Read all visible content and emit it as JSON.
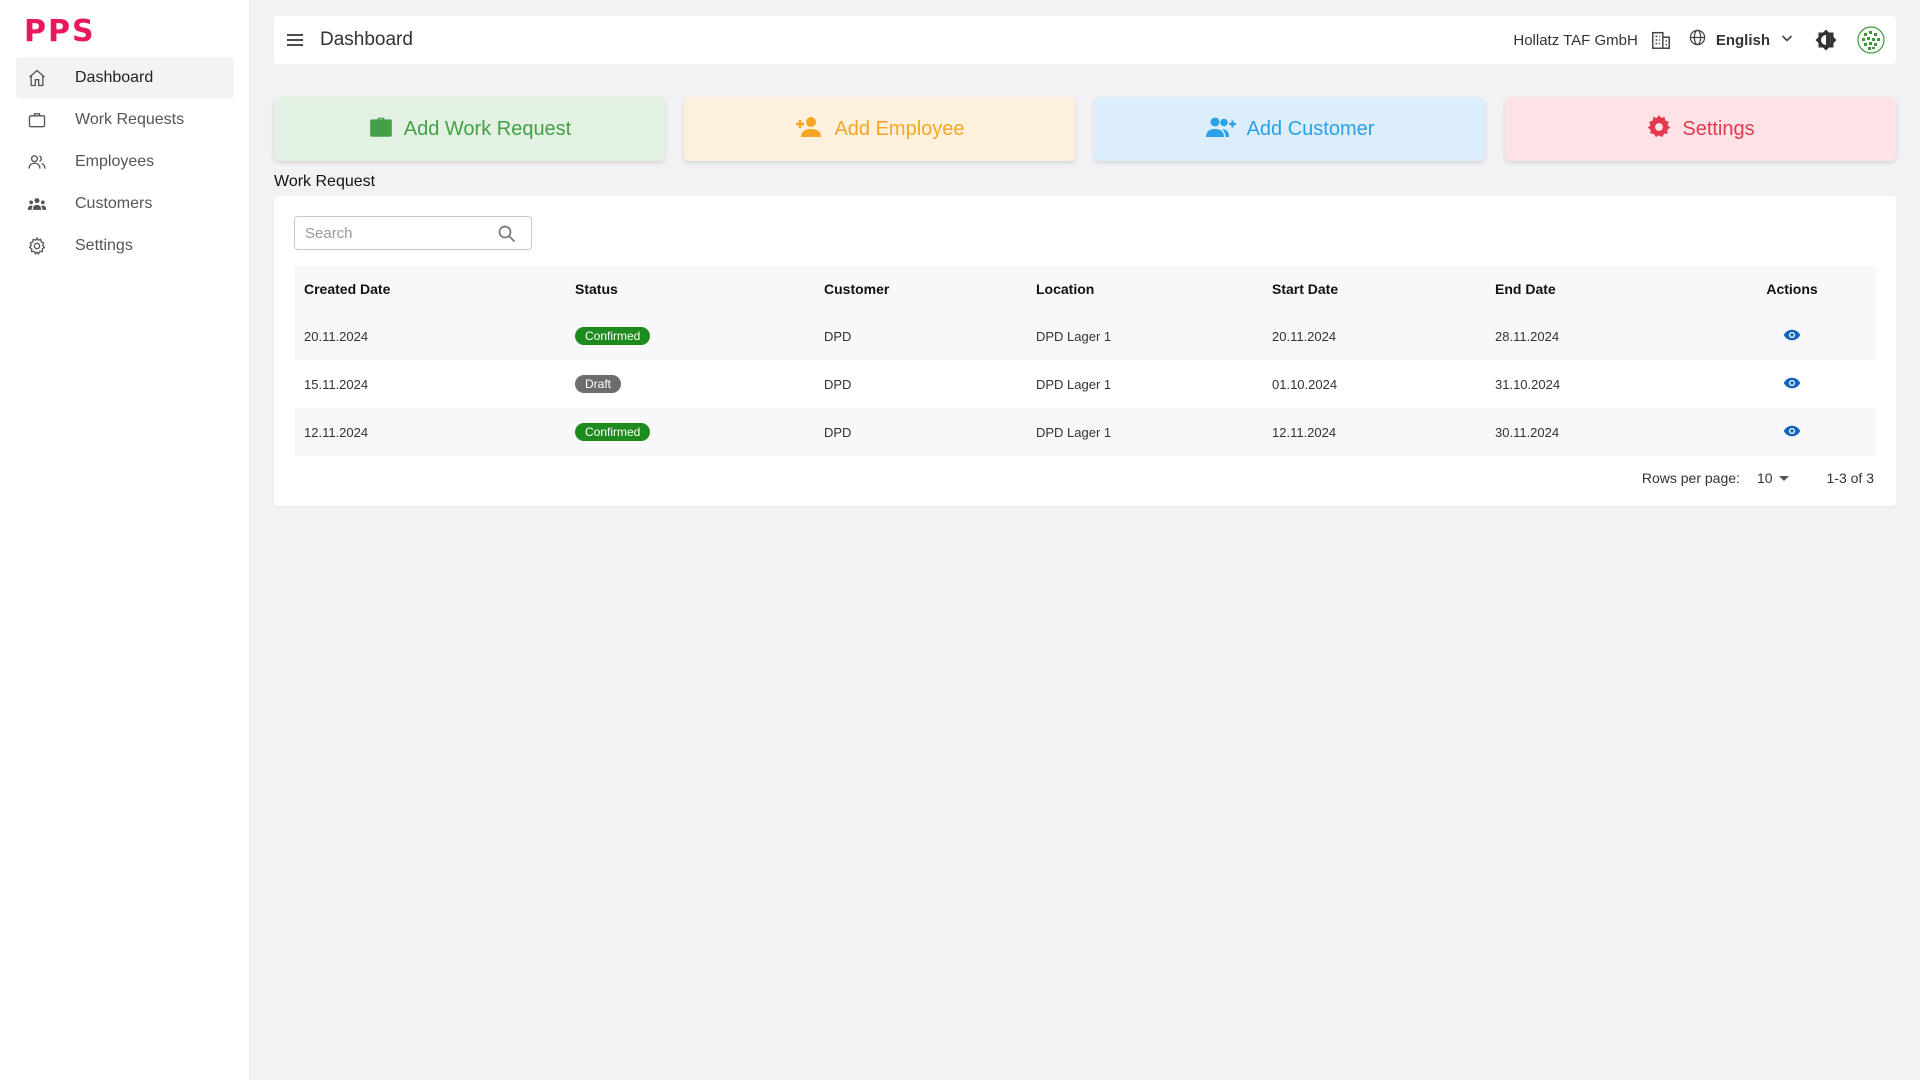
{
  "brand": {
    "logo": "PPS"
  },
  "sidebar": {
    "items": [
      {
        "label": "Dashboard",
        "icon": "home-icon",
        "active": true
      },
      {
        "label": "Work Requests",
        "icon": "briefcase-icon",
        "active": false
      },
      {
        "label": "Employees",
        "icon": "people-icon",
        "active": false
      },
      {
        "label": "Customers",
        "icon": "groups-icon",
        "active": false
      },
      {
        "label": "Settings",
        "icon": "gear-icon",
        "active": false
      }
    ]
  },
  "header": {
    "title": "Dashboard",
    "company": "Hollatz TAF GmbH",
    "language": "English"
  },
  "quick_actions": [
    {
      "label": "Add Work Request",
      "icon": "briefcase-icon",
      "color": "#43a047",
      "bg": "#e3f1e3"
    },
    {
      "label": "Add Employee",
      "icon": "person-add-icon",
      "color": "#f5a623",
      "bg": "#fdf0dd"
    },
    {
      "label": "Add Customer",
      "icon": "group-add-icon",
      "color": "#2aa0e6",
      "bg": "#dcedfb"
    },
    {
      "label": "Settings",
      "icon": "gear-icon",
      "color": "#e53950",
      "bg": "#fde3e5"
    }
  ],
  "work_request": {
    "title": "Work Request",
    "search_placeholder": "Search",
    "columns": [
      "Created Date",
      "Status",
      "Customer",
      "Location",
      "Start Date",
      "End Date",
      "Actions"
    ],
    "rows": [
      {
        "created": "20.11.2024",
        "status": "Confirmed",
        "customer": "DPD",
        "location": "DPD Lager 1",
        "start": "20.11.2024",
        "end": "28.11.2024"
      },
      {
        "created": "15.11.2024",
        "status": "Draft",
        "customer": "DPD",
        "location": "DPD Lager 1",
        "start": "01.10.2024",
        "end": "31.10.2024"
      },
      {
        "created": "12.11.2024",
        "status": "Confirmed",
        "customer": "DPD",
        "location": "DPD Lager 1",
        "start": "12.11.2024",
        "end": "30.11.2024"
      }
    ],
    "pagination": {
      "rows_per_page_label": "Rows per page:",
      "rows_per_page": "10",
      "range": "1-3 of 3"
    }
  },
  "colors": {
    "brand": "#e8185b",
    "confirmed": "#1e8b1e",
    "draft": "#6d6d6d",
    "view_icon": "#1565c0"
  }
}
